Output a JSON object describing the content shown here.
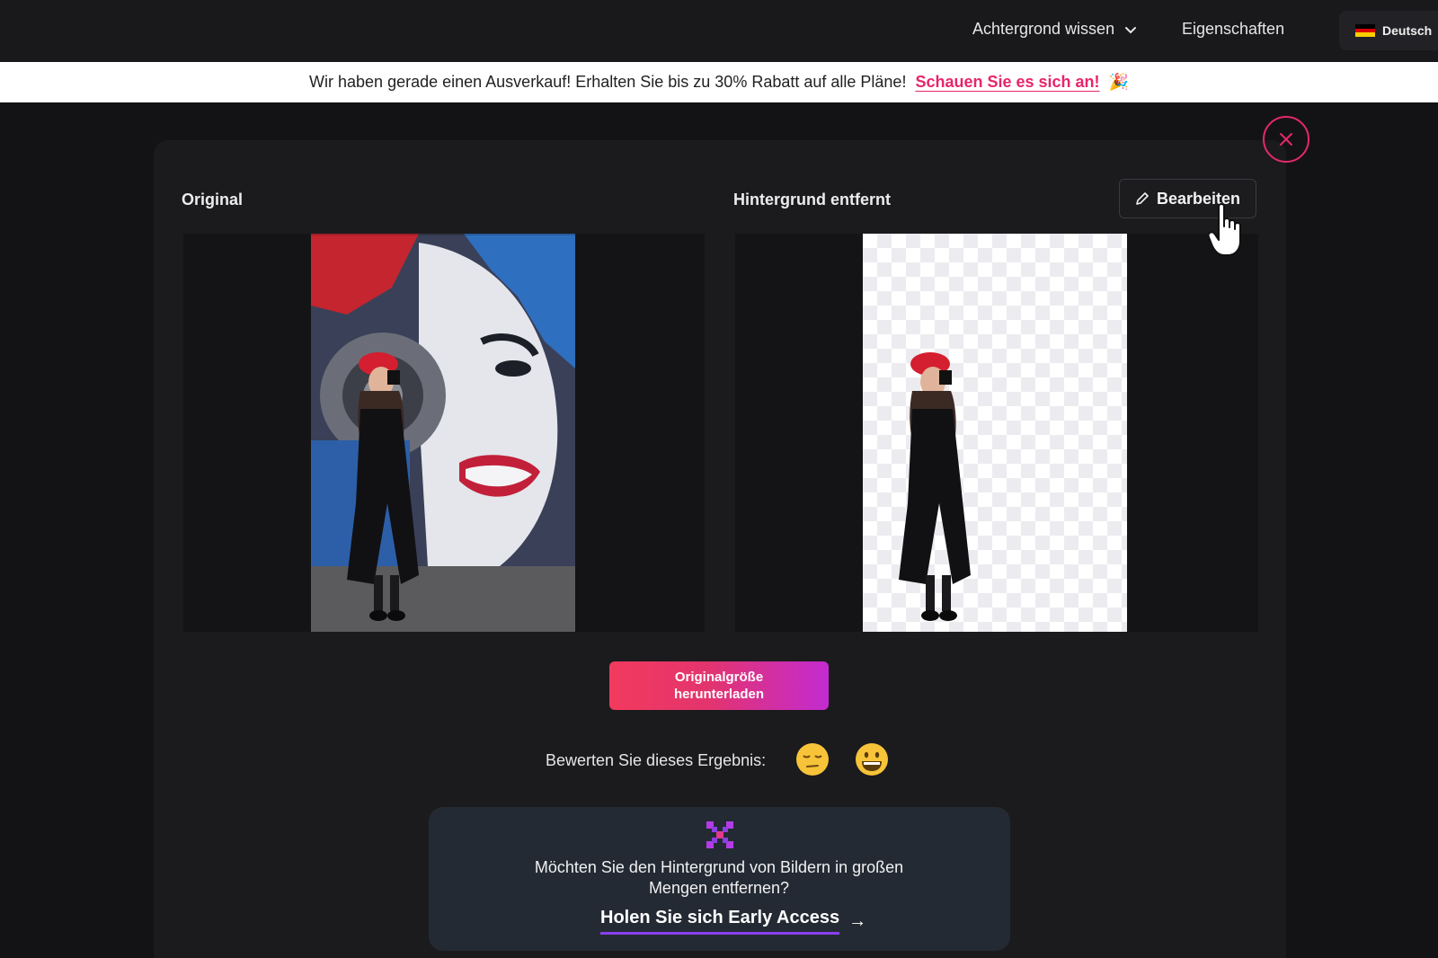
{
  "nav": {
    "knowledge_label": "Achtergrond wissen",
    "properties_label": "Eigenschaften",
    "language_label": "Deutsch"
  },
  "promo": {
    "text": "Wir haben gerade einen Ausverkauf! Erhalten Sie bis zu 30% Rabatt auf alle Pläne!",
    "link_label": "Schauen Sie es sich an!",
    "emoji": "🎉"
  },
  "viewer": {
    "original_title": "Original",
    "removed_title": "Hintergrund entfernt",
    "edit_label": "Bearbeiten"
  },
  "download": {
    "line1": "Originalgröße",
    "line2": "herunterladen"
  },
  "rating": {
    "prompt": "Bewerten Sie dieses Ergebnis:"
  },
  "bulk": {
    "line1": "Möchten Sie den Hintergrund von Bildern in großen",
    "line2": "Mengen entfernen?",
    "link_label": "Holen Sie sich Early Access",
    "arrow": "→"
  },
  "colors": {
    "accent": "#e5286b",
    "gradient_end": "#c32bd0",
    "link_underline": "#8a3ff0"
  }
}
